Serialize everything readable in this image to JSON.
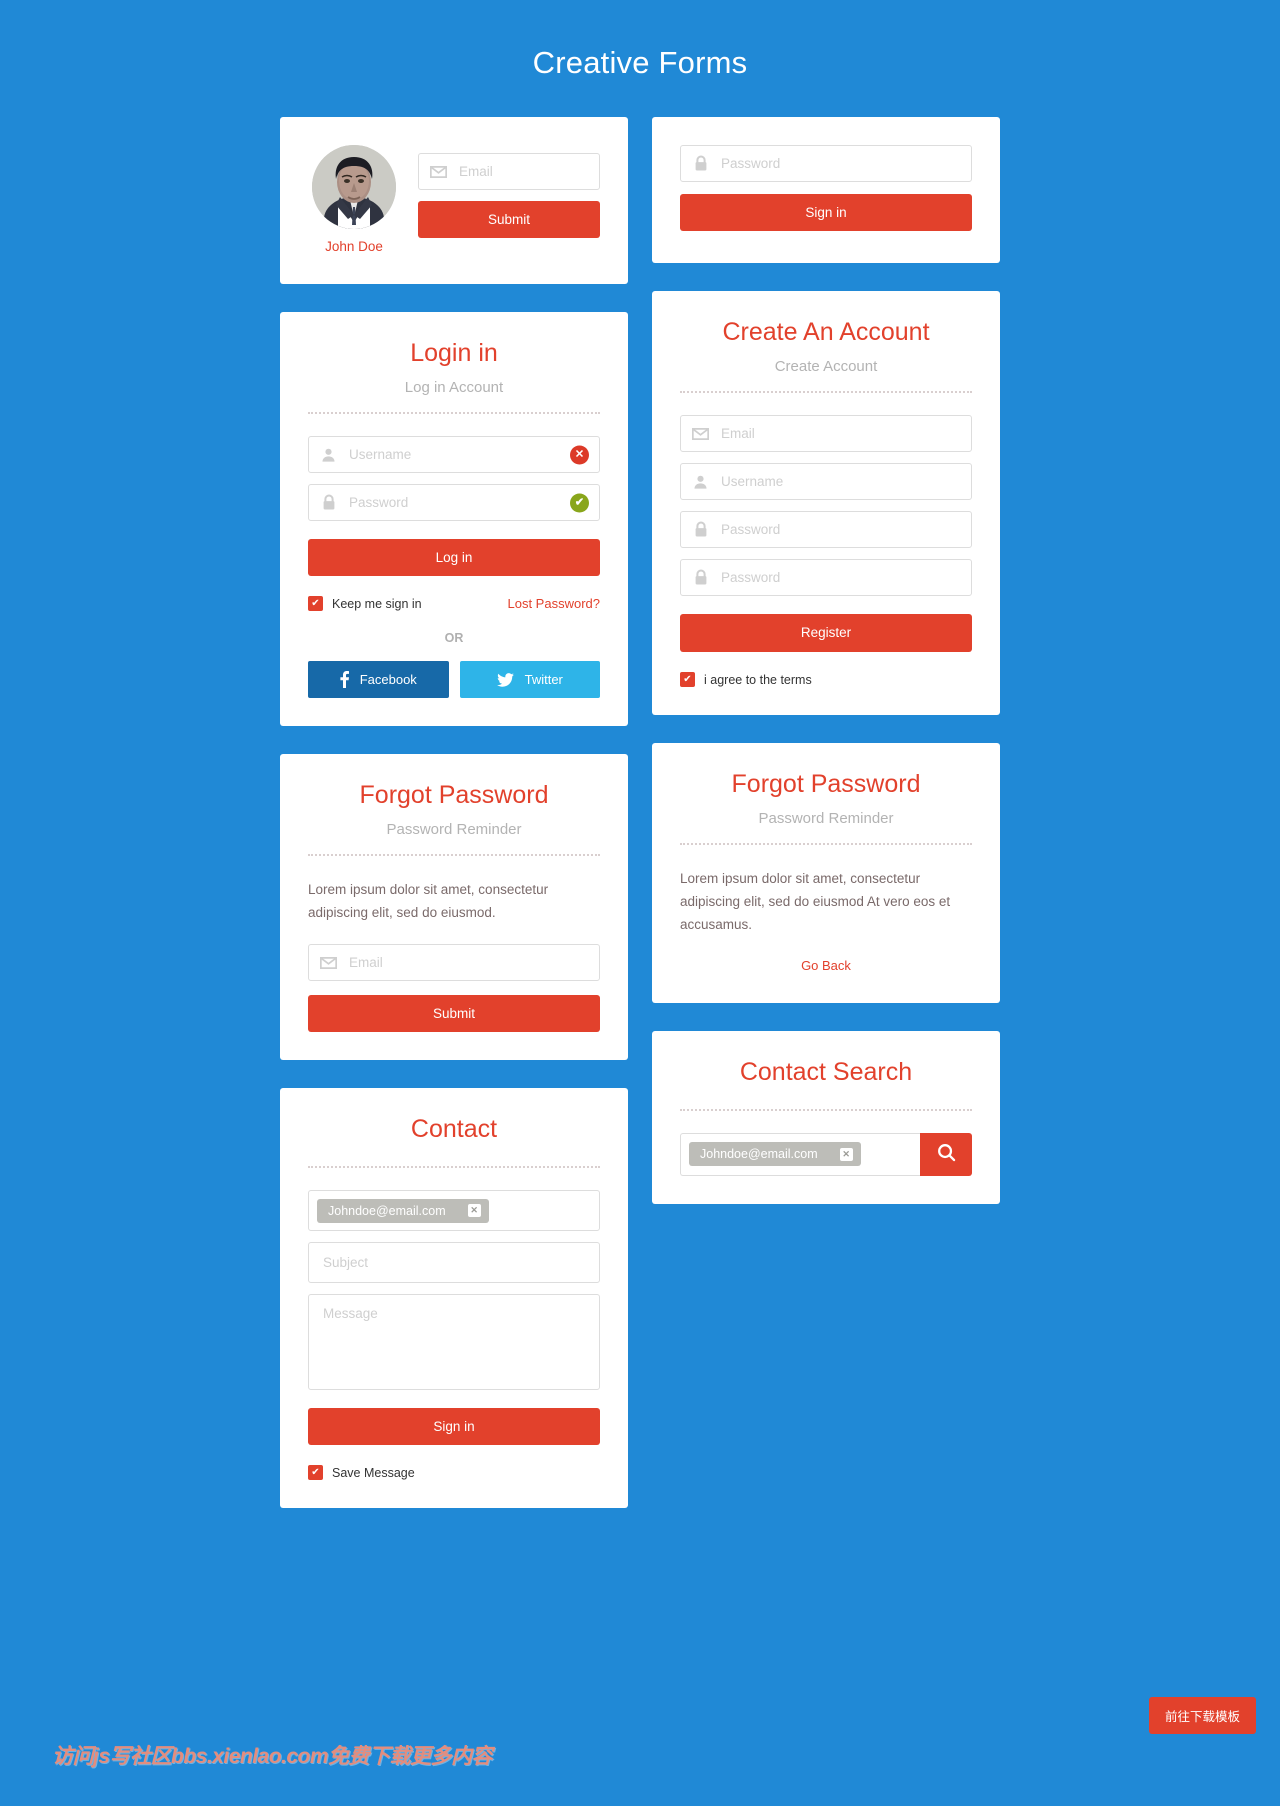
{
  "page": {
    "title": "Creative Forms",
    "bg_color": "#2089d6",
    "accent_color": "#e2412c"
  },
  "profile_card": {
    "avatar_name": "John Doe",
    "email_placeholder": "Email",
    "email_value": "",
    "submit_label": "Submit",
    "email_icon": "envelope-icon"
  },
  "signin_card": {
    "password_placeholder": "Password",
    "password_value": "",
    "signin_label": "Sign in",
    "password_icon": "lock-icon"
  },
  "login_card": {
    "title": "Login in",
    "subtitle": "Log in Account",
    "username_placeholder": "Username",
    "username_value": "",
    "username_icon": "user-icon",
    "username_status": "error",
    "username_status_glyph": "✕",
    "password_placeholder": "Password",
    "password_value": "",
    "password_icon": "lock-icon",
    "password_status": "valid",
    "password_status_glyph": "✔",
    "login_label": "Log in",
    "keep_signed_label": "Keep me sign in",
    "keep_signed_checked": true,
    "lost_password_label": "Lost Password?",
    "or_label": "OR",
    "facebook_label": "Facebook",
    "twitter_label": "Twitter",
    "error_color": "#dc3a28",
    "valid_color": "#89a61b",
    "facebook_color": "#1769a8",
    "twitter_color": "#2eb4e8"
  },
  "register_card": {
    "title": "Create An Account",
    "subtitle": "Create Account",
    "email_placeholder": "Email",
    "email_value": "",
    "email_icon": "envelope-icon",
    "username_placeholder": "Username",
    "username_value": "",
    "username_icon": "user-icon",
    "password_placeholder": "Password",
    "password_value": "",
    "password_icon": "lock-icon",
    "confirm_placeholder": "Password",
    "confirm_value": "",
    "confirm_icon": "lock-icon",
    "register_label": "Register",
    "terms_label": "i agree to the terms",
    "terms_checked": true
  },
  "forgot_left_card": {
    "title": "Forgot Password",
    "subtitle": "Password Reminder",
    "body": "Lorem ipsum dolor sit amet, consectetur adipiscing elit, sed do eiusmod.",
    "email_placeholder": "Email",
    "email_value": "",
    "email_icon": "envelope-icon",
    "submit_label": "Submit"
  },
  "forgot_right_card": {
    "title": "Forgot Password",
    "subtitle": "Password Reminder",
    "body": "Lorem ipsum dolor sit amet, consectetur adipiscing elit, sed do eiusmod At vero eos et accusamus.",
    "go_back_label": "Go Back"
  },
  "contact_card": {
    "title": "Contact",
    "chip_value": "Johndoe@email.com",
    "chip_remove_glyph": "✕",
    "subject_placeholder": "Subject",
    "subject_value": "",
    "message_placeholder": "Message",
    "message_value": "",
    "signin_label": "Sign in",
    "save_message_label": "Save Message",
    "save_message_checked": true
  },
  "contact_search_card": {
    "title": "Contact Search",
    "chip_value": "Johndoe@email.com",
    "chip_remove_glyph": "✕",
    "search_icon": "search-icon"
  },
  "footer": {
    "watermark": "访问јѕ写社区bbs.xienlao.com免费下载更多内容",
    "download_label": "前往下载模板"
  }
}
